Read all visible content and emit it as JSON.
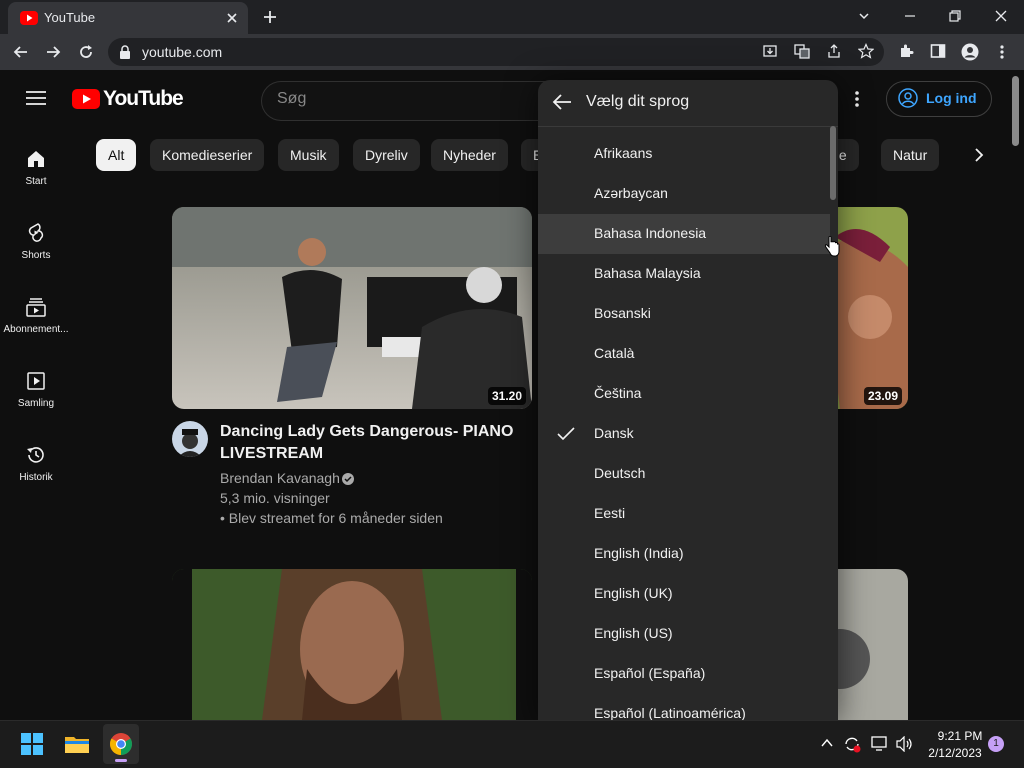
{
  "browser": {
    "tab_title": "YouTube",
    "url": "youtube.com"
  },
  "youtube": {
    "logo_text": "YouTube",
    "search_placeholder": "Søg",
    "login_label": "Log ind",
    "sidebar": [
      {
        "label": "Start",
        "icon": "home-icon"
      },
      {
        "label": "Shorts",
        "icon": "shorts-icon"
      },
      {
        "label": "Abonnement...",
        "icon": "subscriptions-icon"
      },
      {
        "label": "Samling",
        "icon": "library-icon"
      },
      {
        "label": "Historik",
        "icon": "history-icon"
      }
    ],
    "chips": [
      "Alt",
      "Komedieserier",
      "Musik",
      "Dyreliv",
      "Nyheder",
      "E",
      "jde",
      "Natur"
    ],
    "videos": [
      {
        "title": "Dancing Lady Gets Dangerous- PIANO LIVESTREAM",
        "channel": "Brendan Kavanagh",
        "views": "5,3 mio. visninger",
        "age": "• Blev streamet for 6 måneder siden",
        "duration": "31.20"
      },
      {
        "duration": "23.09"
      }
    ]
  },
  "language_menu": {
    "title": "Vælg dit sprog",
    "selected": "Dansk",
    "hovered": "Bahasa Indonesia",
    "items": [
      "Afrikaans",
      "Azərbaycan",
      "Bahasa Indonesia",
      "Bahasa Malaysia",
      "Bosanski",
      "Català",
      "Čeština",
      "Dansk",
      "Deutsch",
      "Eesti",
      "English (India)",
      "English (UK)",
      "English (US)",
      "Español (España)",
      "Español (Latinoamérica)"
    ]
  },
  "taskbar": {
    "time": "9:21 PM",
    "date": "2/12/2023",
    "notifications": "1"
  },
  "colors": {
    "youtube_red": "#ff0000",
    "link_blue": "#3ea6ff",
    "page_bg": "#0f0f0f"
  }
}
